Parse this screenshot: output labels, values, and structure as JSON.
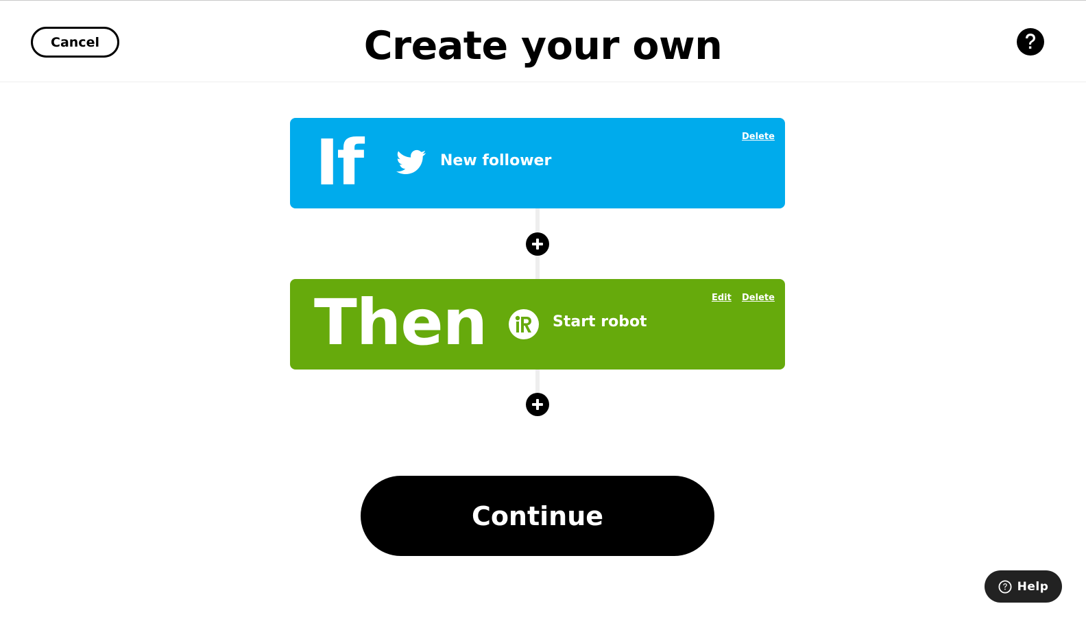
{
  "header": {
    "cancel_label": "Cancel",
    "title": "Create your own",
    "help_icon": "question-circle-icon"
  },
  "trigger": {
    "keyword": "If",
    "service_icon": "twitter-bird-icon",
    "action": "New follower",
    "delete_label": "Delete",
    "color": "#00abec"
  },
  "action": {
    "keyword": "Then",
    "service_icon": "irobot-icon",
    "action": "Start robot",
    "edit_label": "Edit",
    "delete_label": "Delete",
    "color": "#66aa0c"
  },
  "add_icon": "plus-circle-icon",
  "continue_label": "Continue",
  "help_widget": {
    "label": "Help",
    "icon": "question-circle-icon",
    "color": "#222222"
  }
}
